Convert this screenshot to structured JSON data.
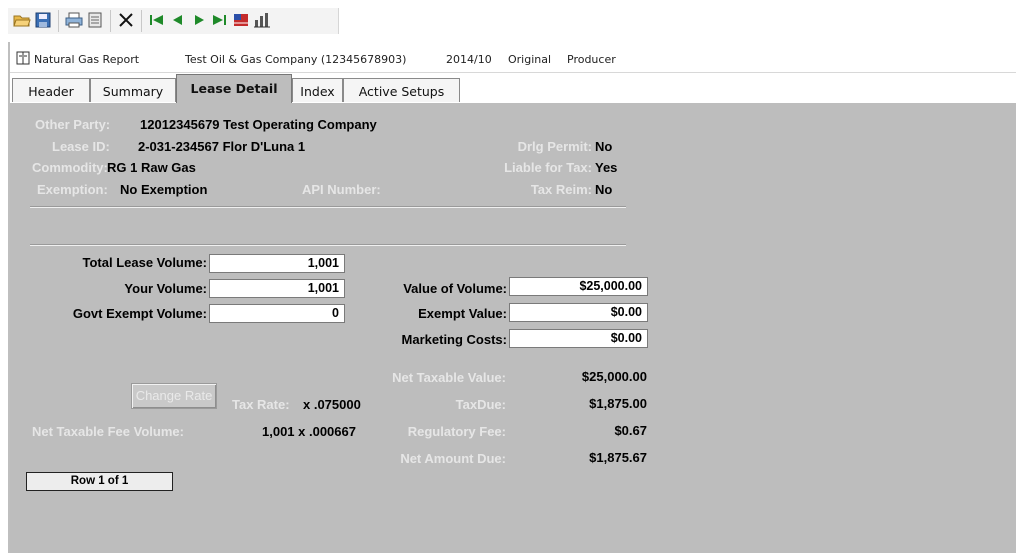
{
  "toolbar": {
    "icons": [
      "open-folder-icon",
      "save-icon",
      "print-icon",
      "preview-icon",
      "delete-x-icon",
      "first-record-icon",
      "previous-record-icon",
      "next-record-icon",
      "last-record-icon",
      "flag-icon",
      "chart-icon"
    ]
  },
  "titlebar": {
    "report": "Natural Gas Report",
    "company": "Test Oil & Gas Company (12345678903)",
    "period": "2014/10",
    "status": "Original",
    "role": "Producer"
  },
  "tabs": [
    {
      "label": "Header"
    },
    {
      "label": "Summary"
    },
    {
      "label": "Lease Detail",
      "active": true
    },
    {
      "label": "Index"
    },
    {
      "label": "Active Setups"
    }
  ],
  "detail": {
    "other_party_label": "Other Party:",
    "other_party_value": "12012345679 Test Operating Company",
    "lease_id_label": "Lease ID:",
    "lease_id_value": "2-031-234567 Flor D'Luna 1",
    "commodity_label": "Commodity:",
    "commodity_value": "RG 1  Raw Gas",
    "exemption_label": "Exemption:",
    "exemption_value": "No Exemption",
    "api_number_label": "API Number:",
    "drlg_permit_label": "Drlg Permit:",
    "drlg_permit_value": "No",
    "liable_label": "Liable for Tax:",
    "liable_value": "Yes",
    "tax_reim_label": "Tax Reim:",
    "tax_reim_value": "No"
  },
  "volumes": {
    "total_lease_label": "Total Lease Volume:",
    "total_lease_value": "1,001",
    "your_volume_label": "Your Volume:",
    "your_volume_value": "1,001",
    "govt_exempt_label": "Govt Exempt Volume:",
    "govt_exempt_value": "0"
  },
  "values": {
    "value_of_volume_label": "Value of Volume:",
    "value_of_volume": "$25,000.00",
    "exempt_value_label": "Exempt Value:",
    "exempt_value": "$0.00",
    "marketing_costs_label": "Marketing Costs:",
    "marketing_costs": "$0.00"
  },
  "computed": {
    "net_taxable_value_label": "Net Taxable Value:",
    "net_taxable_value": "$25,000.00",
    "change_rate_button": "Change Rate",
    "tax_rate_label": "Tax Rate:",
    "tax_rate_value": "x .075000",
    "tax_due_label": "TaxDue:",
    "tax_due": "$1,875.00",
    "net_taxable_fee_volume_label": "Net Taxable Fee Volume:",
    "net_taxable_fee_volume_value": "1,001 x .000667",
    "regulatory_fee_label": "Regulatory Fee:",
    "regulatory_fee": "$0.67",
    "net_amount_due_label": "Net Amount Due:",
    "net_amount_due": "$1,875.67"
  },
  "row_indicator": "Row 1 of 1"
}
